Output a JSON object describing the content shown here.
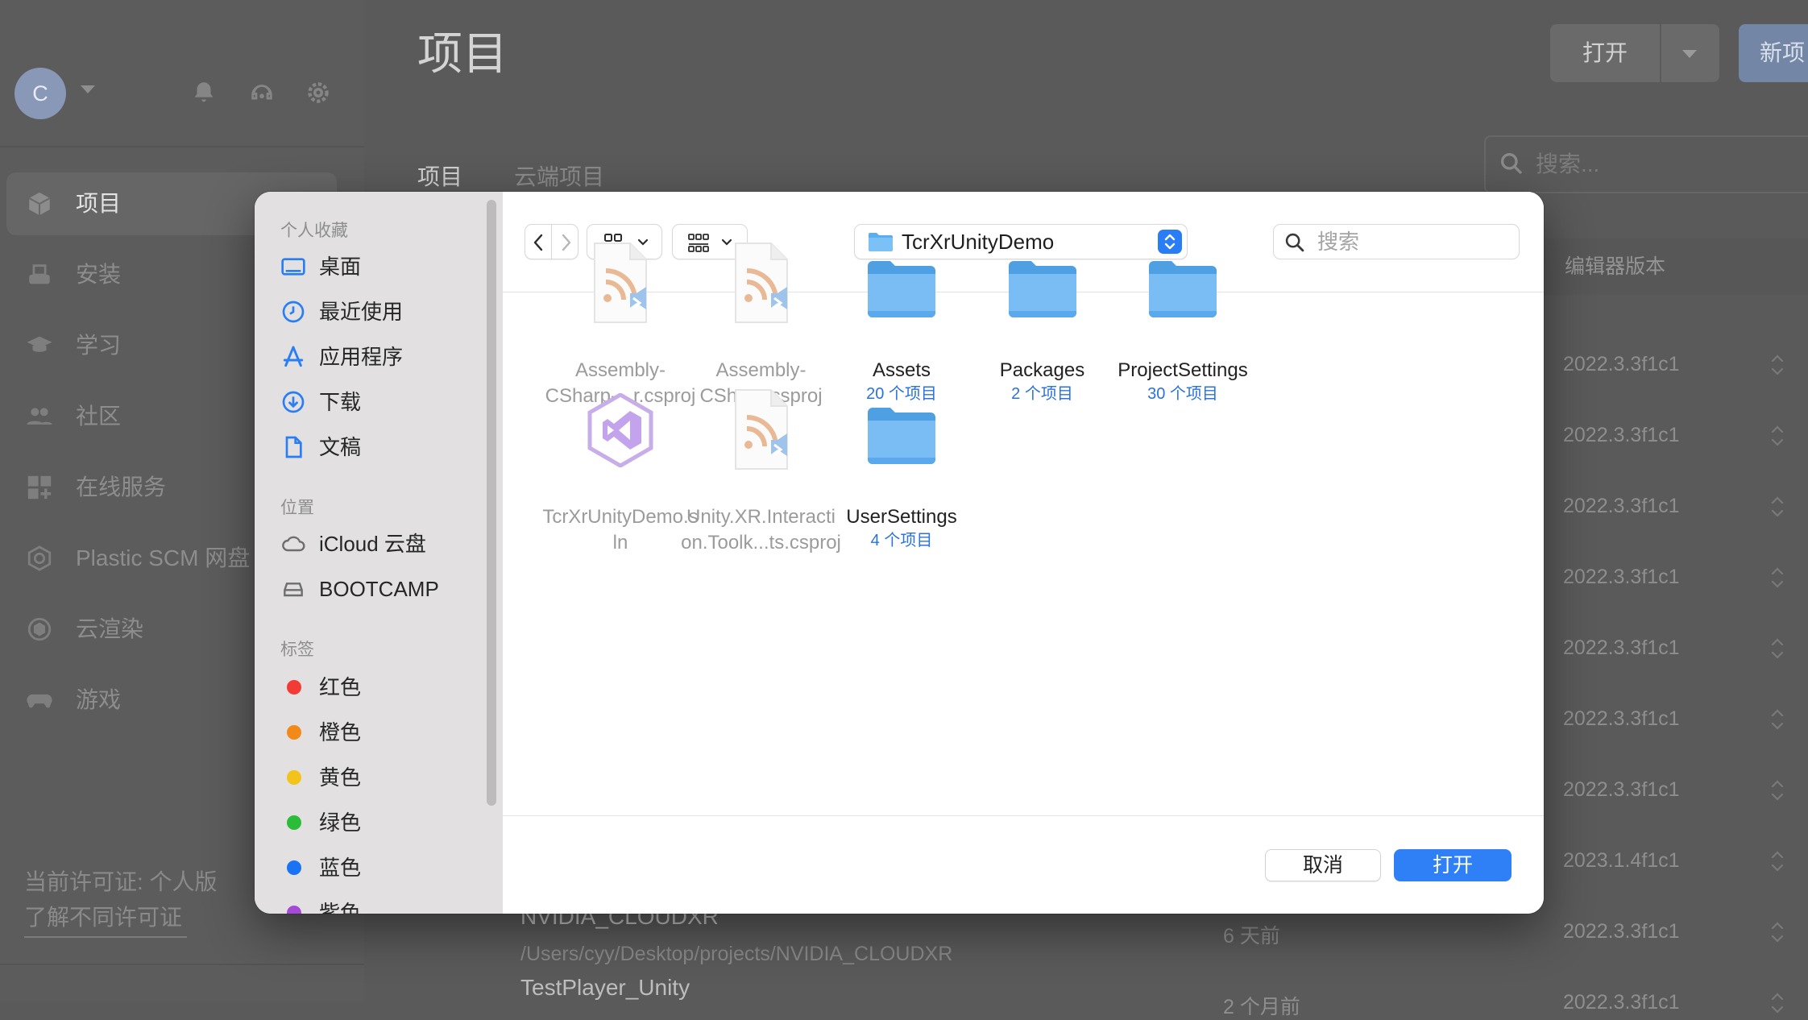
{
  "app": {
    "avatar_initial": "C",
    "page_title": "项目",
    "open_button": "打开",
    "new_button": "新项",
    "tabs": [
      {
        "label": "项目"
      },
      {
        "label": "云端项目"
      }
    ],
    "search_placeholder": "搜索...",
    "column_editor_version": "编辑器版本",
    "nav": [
      {
        "label": "项目",
        "icon": "cube-icon",
        "active": true
      },
      {
        "label": "安装",
        "icon": "drive-icon"
      },
      {
        "label": "学习",
        "icon": "graduation-cap-icon"
      },
      {
        "label": "社区",
        "icon": "people-icon"
      },
      {
        "label": "在线服务",
        "icon": "grid-plus-icon"
      },
      {
        "label": "Plastic SCM 网盘",
        "icon": "plastic-scm-icon"
      },
      {
        "label": "云渲染",
        "icon": "cloud-render-icon"
      },
      {
        "label": "游戏",
        "icon": "gamepad-icon"
      }
    ],
    "license_label": "当前许可证: 个人版",
    "license_link": "了解不同许可证",
    "versions": [
      "2022.3.3f1c1",
      "2022.3.3f1c1",
      "2022.3.3f1c1",
      "2022.3.3f1c1",
      "2022.3.3f1c1",
      "2022.3.3f1c1",
      "2022.3.3f1c1",
      "2023.1.4f1c1",
      "2022.3.3f1c1",
      "2022.3.3f1c1"
    ],
    "projects_visible": [
      {
        "name": "NVIDIA_CLOUDXR",
        "path": "/Users/cyy/Desktop/projects/NVIDIA_CLOUDXR",
        "time": "6 天前"
      },
      {
        "name": "TestPlayer_Unity",
        "path": "",
        "time": "2 个月前"
      }
    ]
  },
  "dialog": {
    "sidebar": {
      "favorites_title": "个人收藏",
      "favorites": [
        {
          "label": "桌面",
          "icon": "desktop-icon"
        },
        {
          "label": "最近使用",
          "icon": "clock-icon"
        },
        {
          "label": "应用程序",
          "icon": "applications-icon"
        },
        {
          "label": "下载",
          "icon": "download-icon"
        },
        {
          "label": "文稿",
          "icon": "document-icon"
        }
      ],
      "locations_title": "位置",
      "locations": [
        {
          "label": "iCloud 云盘",
          "icon": "icloud-icon"
        },
        {
          "label": "BOOTCAMP",
          "icon": "disk-icon"
        }
      ],
      "tags_title": "标签",
      "tags": [
        {
          "label": "红色",
          "color": "#f33b35"
        },
        {
          "label": "橙色",
          "color": "#f28a1a"
        },
        {
          "label": "黄色",
          "color": "#f2c31a"
        },
        {
          "label": "绿色",
          "color": "#2bbd3a"
        },
        {
          "label": "蓝色",
          "color": "#1a73f2"
        },
        {
          "label": "紫色",
          "color": "#a54ad6"
        }
      ]
    },
    "path_popup": "TcrXrUnityDemo",
    "search_placeholder": "搜索",
    "files": [
      {
        "name_lines": [
          "Assembly-",
          "CSharp-...r.csproj"
        ],
        "sub": "",
        "kind": "csproj",
        "dim": true
      },
      {
        "name_lines": [
          "Assembly-",
          "CSharp.csproj"
        ],
        "sub": "",
        "kind": "csproj",
        "dim": true
      },
      {
        "name_lines": [
          "Assets"
        ],
        "sub": "20 个项目",
        "kind": "folder",
        "dim": false
      },
      {
        "name_lines": [
          "Packages"
        ],
        "sub": "2 个项目",
        "kind": "folder",
        "dim": false
      },
      {
        "name_lines": [
          "ProjectSettings"
        ],
        "sub": "30 个项目",
        "kind": "folder",
        "dim": false
      },
      {
        "name_lines": [
          "TcrXrUnityDemo.s",
          "ln"
        ],
        "sub": "",
        "kind": "sln",
        "dim": true
      },
      {
        "name_lines": [
          "Unity.XR.Interacti",
          "on.Toolk...ts.csproj"
        ],
        "sub": "",
        "kind": "csproj",
        "dim": true
      },
      {
        "name_lines": [
          "UserSettings"
        ],
        "sub": "4 个项目",
        "kind": "folder",
        "dim": false
      }
    ],
    "cancel_button": "取消",
    "open_button": "打开",
    "accent_color": "#2f80f6"
  }
}
